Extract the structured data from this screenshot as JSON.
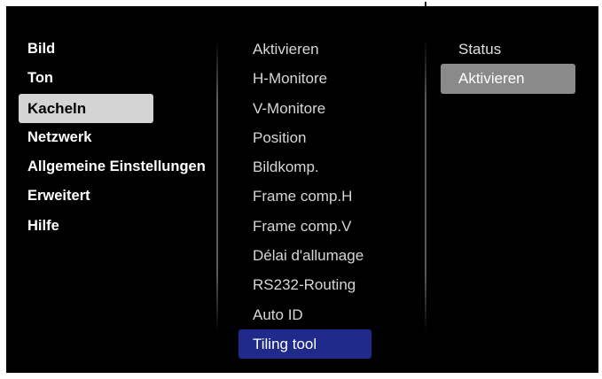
{
  "menu": {
    "main": [
      "Bild",
      "Ton",
      "Kacheln",
      "Netzwerk",
      "Allgemeine Einstellungen",
      "Erweitert",
      "Hilfe"
    ],
    "main_selected_index": 2,
    "sub": [
      "Aktivieren",
      "H-Monitore",
      "V-Monitore",
      "Position",
      "Bildkomp.",
      "Frame comp.H",
      "Frame comp.V",
      "Délai d'allumage",
      "RS232-Routing",
      "Auto ID",
      "Tiling tool"
    ],
    "sub_selected_index": 10,
    "options": [
      "Status",
      "Aktivieren"
    ],
    "options_selected_index": 1
  },
  "colors": {
    "background": "#000000",
    "main_highlight": "#d4d4d4",
    "sub_highlight": "#1f2a8a",
    "option_highlight": "#8a8a8a"
  }
}
